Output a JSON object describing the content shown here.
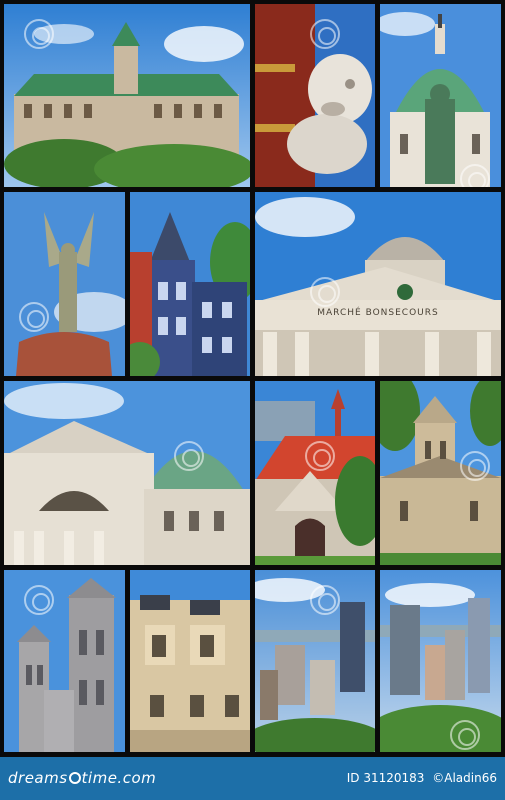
{
  "photos": [
    {
      "label": "green-roof-city-hall"
    },
    {
      "label": "chinese-lion-statue"
    },
    {
      "label": "domed-cathedral-statue"
    },
    {
      "label": "angel-monument"
    },
    {
      "label": "victorian-row-houses"
    },
    {
      "label": "marche-bonsecours-dome"
    },
    {
      "label": "domed-basilica"
    },
    {
      "label": "red-roof-church"
    },
    {
      "label": "stone-gothic-church"
    },
    {
      "label": "notre-dame-towers"
    },
    {
      "label": "ornate-stone-facade"
    },
    {
      "label": "skyline-view"
    },
    {
      "label": "downtown-towers"
    }
  ],
  "sign_text": "MARCHÉ BONSECOURS",
  "footer": {
    "logo_text_left": "dreams",
    "logo_text_right": "time.com",
    "id_label": "ID 31120183",
    "copyright": "©",
    "author": "Aladin66"
  },
  "colors": {
    "footer_bg": "#1d6fa8",
    "sky": "#3b86d6",
    "copper_green": "#5aa57a"
  }
}
